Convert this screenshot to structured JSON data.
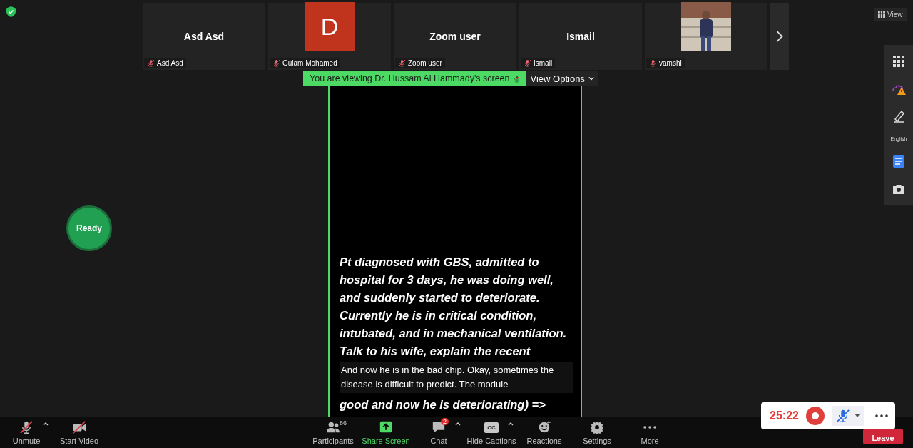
{
  "view_button": {
    "label": "View"
  },
  "participants": [
    {
      "kind": "name",
      "tile_text": "Asd Asd",
      "name": "Asd Asd",
      "muted": true
    },
    {
      "kind": "avatar",
      "tile_text": "D",
      "name": "Gulam Mohamed",
      "muted": true
    },
    {
      "kind": "name",
      "tile_text": "Zoom user",
      "name": "Zoom user",
      "muted": true
    },
    {
      "kind": "name",
      "tile_text": "Ismail",
      "name": "Ismail",
      "muted": true
    },
    {
      "name": "vamshi",
      "muted": true
    }
  ],
  "share_banner": {
    "text": "You are viewing Dr. Hussam Al Hammady's screen",
    "view_options": "View Options"
  },
  "shared_screen": {
    "lines": [
      "Pt diagnosed with GBS, admitted to",
      "hospital for 3 days, he was doing well,",
      "and suddenly started to deteriorate.",
      "Currently he is in critical condition,",
      "intubated, and in mechanical ventilation.",
      "Talk to his wife, explain the recent"
    ],
    "last_line": "good and now he is deteriorating) =>"
  },
  "captions": [
    "And now he is in the bad chip. Okay, sometimes the",
    "disease is difficult to predict. The module"
  ],
  "ready_badge": "Ready",
  "side_toolbar": {
    "language": "English"
  },
  "toolbar": [
    {
      "kind": "unmute",
      "label": "Unmute",
      "caret": true
    },
    {
      "kind": "video",
      "label": "Start Video",
      "caret": false
    },
    {
      "kind": "participants",
      "label": "Participants",
      "count": "86",
      "caret": false
    },
    {
      "kind": "share",
      "label": "Share Screen",
      "caret": false
    },
    {
      "kind": "chat",
      "label": "Chat",
      "badge": "2",
      "caret": true
    },
    {
      "kind": "captions",
      "label": "Hide Captions",
      "icon_text": "CC",
      "caret": true
    },
    {
      "kind": "reactions",
      "label": "Reactions",
      "caret": false
    },
    {
      "kind": "settings",
      "label": "Settings",
      "caret": false
    },
    {
      "kind": "more",
      "label": "More",
      "caret": false
    }
  ],
  "leave_button": "Leave",
  "recorder": {
    "time": "25:22",
    "recording": true,
    "muted": true
  }
}
